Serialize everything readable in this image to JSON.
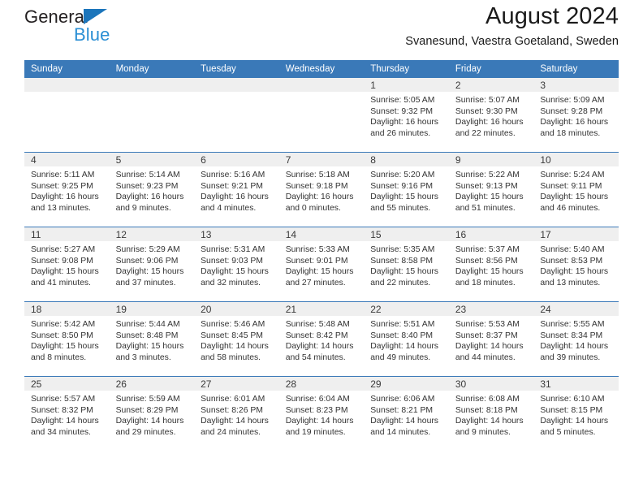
{
  "brand": {
    "name_top": "General",
    "name_bottom": "Blue",
    "triangle_color": "#1b75bb",
    "blue_color": "#2b8fd4"
  },
  "header": {
    "title": "August 2024",
    "subtitle": "Svanesund, Vaestra Goetaland, Sweden"
  },
  "theme": {
    "header_bg": "#3a79b8",
    "daynum_bg": "#efefef",
    "rule_color": "#3a79b8"
  },
  "calendar": {
    "weekday_headers": [
      "Sunday",
      "Monday",
      "Tuesday",
      "Wednesday",
      "Thursday",
      "Friday",
      "Saturday"
    ],
    "weeks": [
      [
        {
          "day": "",
          "empty": true
        },
        {
          "day": "",
          "empty": true
        },
        {
          "day": "",
          "empty": true
        },
        {
          "day": "",
          "empty": true
        },
        {
          "day": "1",
          "sunrise": "Sunrise: 5:05 AM",
          "sunset": "Sunset: 9:32 PM",
          "daylight1": "Daylight: 16 hours",
          "daylight2": "and 26 minutes."
        },
        {
          "day": "2",
          "sunrise": "Sunrise: 5:07 AM",
          "sunset": "Sunset: 9:30 PM",
          "daylight1": "Daylight: 16 hours",
          "daylight2": "and 22 minutes."
        },
        {
          "day": "3",
          "sunrise": "Sunrise: 5:09 AM",
          "sunset": "Sunset: 9:28 PM",
          "daylight1": "Daylight: 16 hours",
          "daylight2": "and 18 minutes."
        }
      ],
      [
        {
          "day": "4",
          "sunrise": "Sunrise: 5:11 AM",
          "sunset": "Sunset: 9:25 PM",
          "daylight1": "Daylight: 16 hours",
          "daylight2": "and 13 minutes."
        },
        {
          "day": "5",
          "sunrise": "Sunrise: 5:14 AM",
          "sunset": "Sunset: 9:23 PM",
          "daylight1": "Daylight: 16 hours",
          "daylight2": "and 9 minutes."
        },
        {
          "day": "6",
          "sunrise": "Sunrise: 5:16 AM",
          "sunset": "Sunset: 9:21 PM",
          "daylight1": "Daylight: 16 hours",
          "daylight2": "and 4 minutes."
        },
        {
          "day": "7",
          "sunrise": "Sunrise: 5:18 AM",
          "sunset": "Sunset: 9:18 PM",
          "daylight1": "Daylight: 16 hours",
          "daylight2": "and 0 minutes."
        },
        {
          "day": "8",
          "sunrise": "Sunrise: 5:20 AM",
          "sunset": "Sunset: 9:16 PM",
          "daylight1": "Daylight: 15 hours",
          "daylight2": "and 55 minutes."
        },
        {
          "day": "9",
          "sunrise": "Sunrise: 5:22 AM",
          "sunset": "Sunset: 9:13 PM",
          "daylight1": "Daylight: 15 hours",
          "daylight2": "and 51 minutes."
        },
        {
          "day": "10",
          "sunrise": "Sunrise: 5:24 AM",
          "sunset": "Sunset: 9:11 PM",
          "daylight1": "Daylight: 15 hours",
          "daylight2": "and 46 minutes."
        }
      ],
      [
        {
          "day": "11",
          "sunrise": "Sunrise: 5:27 AM",
          "sunset": "Sunset: 9:08 PM",
          "daylight1": "Daylight: 15 hours",
          "daylight2": "and 41 minutes."
        },
        {
          "day": "12",
          "sunrise": "Sunrise: 5:29 AM",
          "sunset": "Sunset: 9:06 PM",
          "daylight1": "Daylight: 15 hours",
          "daylight2": "and 37 minutes."
        },
        {
          "day": "13",
          "sunrise": "Sunrise: 5:31 AM",
          "sunset": "Sunset: 9:03 PM",
          "daylight1": "Daylight: 15 hours",
          "daylight2": "and 32 minutes."
        },
        {
          "day": "14",
          "sunrise": "Sunrise: 5:33 AM",
          "sunset": "Sunset: 9:01 PM",
          "daylight1": "Daylight: 15 hours",
          "daylight2": "and 27 minutes."
        },
        {
          "day": "15",
          "sunrise": "Sunrise: 5:35 AM",
          "sunset": "Sunset: 8:58 PM",
          "daylight1": "Daylight: 15 hours",
          "daylight2": "and 22 minutes."
        },
        {
          "day": "16",
          "sunrise": "Sunrise: 5:37 AM",
          "sunset": "Sunset: 8:56 PM",
          "daylight1": "Daylight: 15 hours",
          "daylight2": "and 18 minutes."
        },
        {
          "day": "17",
          "sunrise": "Sunrise: 5:40 AM",
          "sunset": "Sunset: 8:53 PM",
          "daylight1": "Daylight: 15 hours",
          "daylight2": "and 13 minutes."
        }
      ],
      [
        {
          "day": "18",
          "sunrise": "Sunrise: 5:42 AM",
          "sunset": "Sunset: 8:50 PM",
          "daylight1": "Daylight: 15 hours",
          "daylight2": "and 8 minutes."
        },
        {
          "day": "19",
          "sunrise": "Sunrise: 5:44 AM",
          "sunset": "Sunset: 8:48 PM",
          "daylight1": "Daylight: 15 hours",
          "daylight2": "and 3 minutes."
        },
        {
          "day": "20",
          "sunrise": "Sunrise: 5:46 AM",
          "sunset": "Sunset: 8:45 PM",
          "daylight1": "Daylight: 14 hours",
          "daylight2": "and 58 minutes."
        },
        {
          "day": "21",
          "sunrise": "Sunrise: 5:48 AM",
          "sunset": "Sunset: 8:42 PM",
          "daylight1": "Daylight: 14 hours",
          "daylight2": "and 54 minutes."
        },
        {
          "day": "22",
          "sunrise": "Sunrise: 5:51 AM",
          "sunset": "Sunset: 8:40 PM",
          "daylight1": "Daylight: 14 hours",
          "daylight2": "and 49 minutes."
        },
        {
          "day": "23",
          "sunrise": "Sunrise: 5:53 AM",
          "sunset": "Sunset: 8:37 PM",
          "daylight1": "Daylight: 14 hours",
          "daylight2": "and 44 minutes."
        },
        {
          "day": "24",
          "sunrise": "Sunrise: 5:55 AM",
          "sunset": "Sunset: 8:34 PM",
          "daylight1": "Daylight: 14 hours",
          "daylight2": "and 39 minutes."
        }
      ],
      [
        {
          "day": "25",
          "sunrise": "Sunrise: 5:57 AM",
          "sunset": "Sunset: 8:32 PM",
          "daylight1": "Daylight: 14 hours",
          "daylight2": "and 34 minutes."
        },
        {
          "day": "26",
          "sunrise": "Sunrise: 5:59 AM",
          "sunset": "Sunset: 8:29 PM",
          "daylight1": "Daylight: 14 hours",
          "daylight2": "and 29 minutes."
        },
        {
          "day": "27",
          "sunrise": "Sunrise: 6:01 AM",
          "sunset": "Sunset: 8:26 PM",
          "daylight1": "Daylight: 14 hours",
          "daylight2": "and 24 minutes."
        },
        {
          "day": "28",
          "sunrise": "Sunrise: 6:04 AM",
          "sunset": "Sunset: 8:23 PM",
          "daylight1": "Daylight: 14 hours",
          "daylight2": "and 19 minutes."
        },
        {
          "day": "29",
          "sunrise": "Sunrise: 6:06 AM",
          "sunset": "Sunset: 8:21 PM",
          "daylight1": "Daylight: 14 hours",
          "daylight2": "and 14 minutes."
        },
        {
          "day": "30",
          "sunrise": "Sunrise: 6:08 AM",
          "sunset": "Sunset: 8:18 PM",
          "daylight1": "Daylight: 14 hours",
          "daylight2": "and 9 minutes."
        },
        {
          "day": "31",
          "sunrise": "Sunrise: 6:10 AM",
          "sunset": "Sunset: 8:15 PM",
          "daylight1": "Daylight: 14 hours",
          "daylight2": "and 5 minutes."
        }
      ]
    ]
  }
}
